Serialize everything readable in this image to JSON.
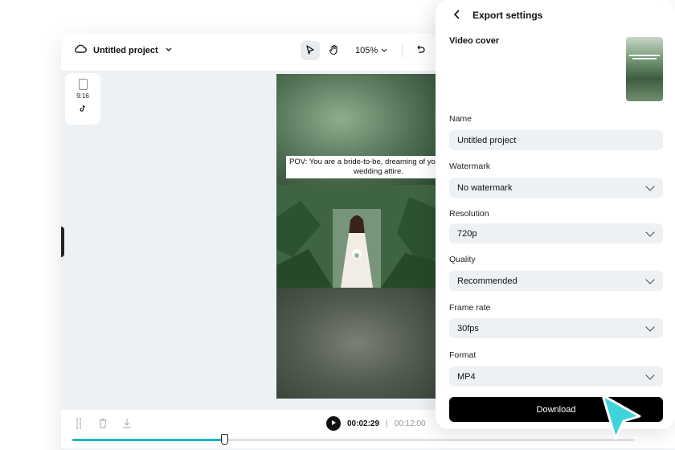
{
  "editor": {
    "project_title": "Untitled project",
    "zoom": "105%",
    "aspect_ratio": "9:16",
    "caption": "POV: You are a bride-to-be, dreaming of your perfect wedding attire.",
    "current_time": "00:02:29",
    "total_time": "00:12:00",
    "time_separator": "|",
    "progress_fraction": 0.27
  },
  "panel": {
    "title": "Export settings",
    "video_cover_label": "Video cover",
    "name_label": "Name",
    "name_value": "Untitled project",
    "watermark_label": "Watermark",
    "watermark_value": "No watermark",
    "resolution_label": "Resolution",
    "resolution_value": "720p",
    "quality_label": "Quality",
    "quality_value": "Recommended",
    "frame_rate_label": "Frame rate",
    "frame_rate_value": "30fps",
    "format_label": "Format",
    "format_value": "MP4",
    "download_label": "Download"
  },
  "colors": {
    "accent": "#19b5c6",
    "cursor": "#3ed3dd",
    "button": "#000000"
  },
  "icons": [
    "cloud-icon",
    "chevron-down-icon",
    "select-pointer-icon",
    "hand-icon",
    "undo-icon",
    "tiktok-icon",
    "split-icon",
    "trash-icon",
    "download-icon",
    "play-icon",
    "back-arrow-icon"
  ]
}
